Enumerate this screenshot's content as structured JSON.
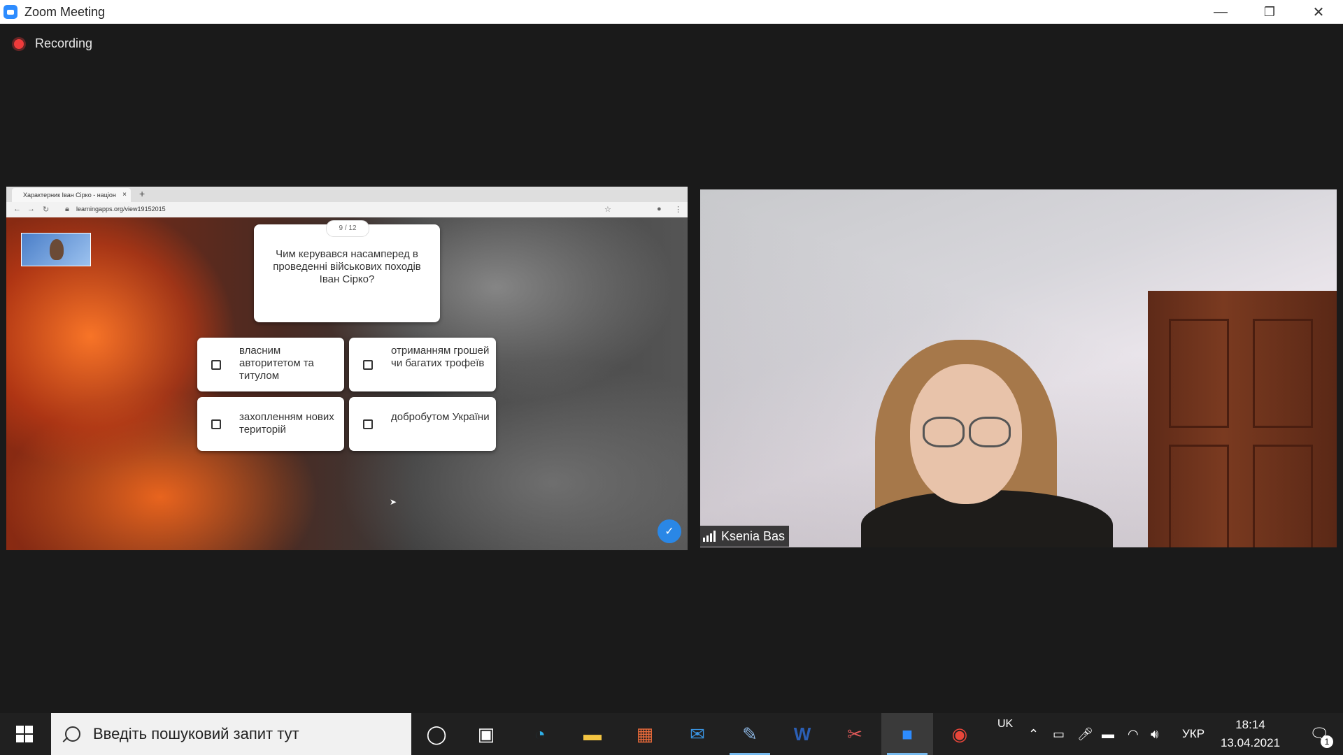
{
  "window": {
    "title": "Zoom Meeting",
    "minimize_glyph": "—",
    "restore_glyph": "❐",
    "close_glyph": "✕"
  },
  "recording": {
    "label": "Recording"
  },
  "shared_screen": {
    "tab_title": "Характерник Іван Сірко - націон",
    "tab_close": "×",
    "new_tab": "+",
    "url": "learningapps.org/view19152015",
    "quiz": {
      "counter": "9 / 12",
      "question": "Чим керувався насамперед в проведенні військових походів Іван Сірко?",
      "answers": [
        "власним авторитетом та титулом",
        "отриманням грошей чи багатих трофеїв",
        "захопленням нових територій",
        "добробутом України"
      ]
    }
  },
  "video": {
    "participant_name": "Ksenia Bas"
  },
  "taskbar": {
    "search_placeholder": "Введіть пошуковий запит тут",
    "icons": [
      "cortana-icon",
      "task-view-icon",
      "edge-icon",
      "file-explorer-icon",
      "store-icon",
      "mail-icon",
      "paint-icon",
      "word-icon",
      "snipping-icon",
      "zoom-icon",
      "chrome-icon"
    ],
    "word_glyph": "W",
    "keyboard_layout_top": "UK",
    "language": "УКР",
    "time": "18:14",
    "date": "13.04.2021",
    "notification_count": "1"
  }
}
